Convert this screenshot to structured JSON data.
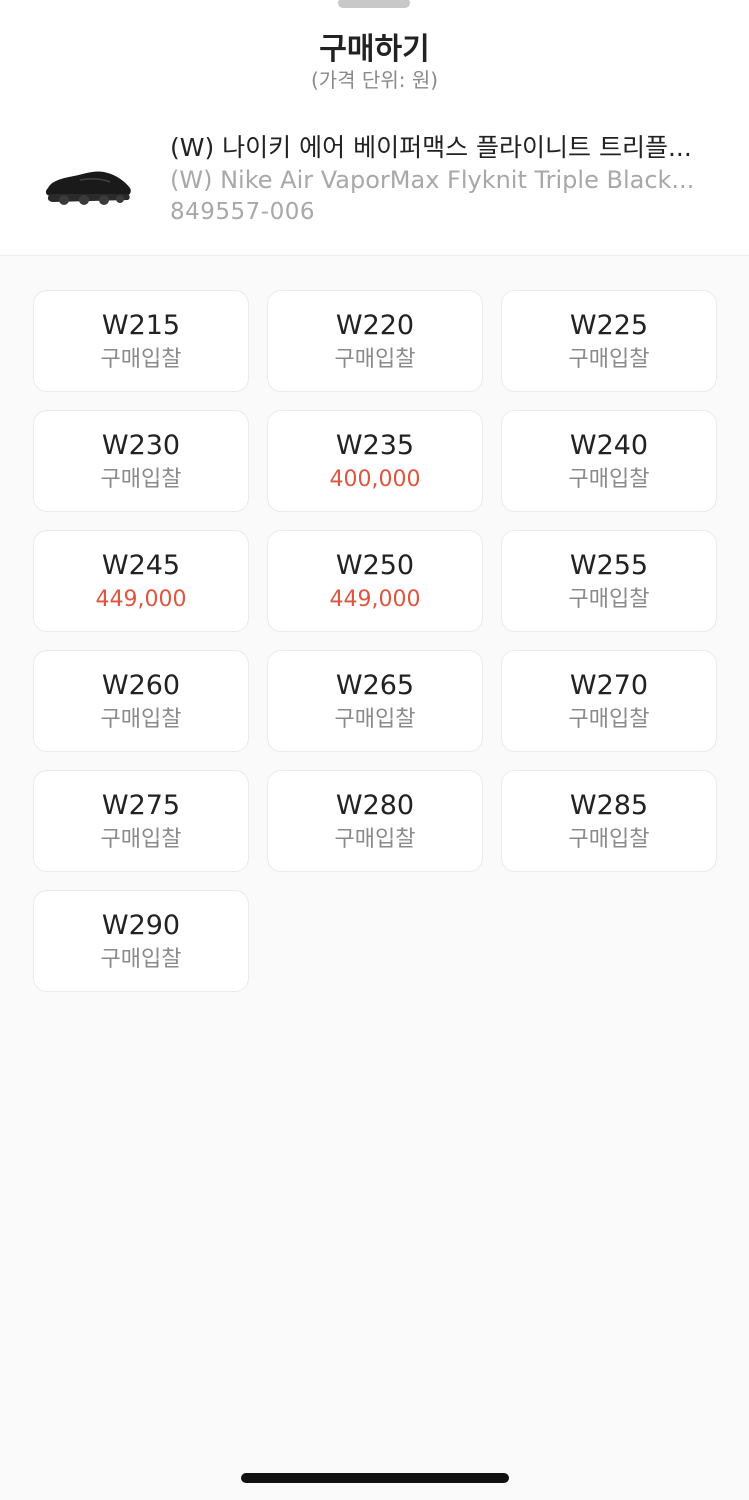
{
  "sheet": {
    "title": "구매하기",
    "subtitle": "(가격 단위: 원)"
  },
  "product": {
    "name_ko": "(W) 나이키 에어 베이퍼맥스 플라이니트 트리플...",
    "name_en": "(W) Nike Air VaporMax Flyknit Triple Black...",
    "code": "849557-006",
    "thumbnail_icon": "sneaker-image"
  },
  "sizes": [
    {
      "size": "W215",
      "price": "구매입찰",
      "has_price": false
    },
    {
      "size": "W220",
      "price": "구매입찰",
      "has_price": false
    },
    {
      "size": "W225",
      "price": "구매입찰",
      "has_price": false
    },
    {
      "size": "W230",
      "price": "구매입찰",
      "has_price": false
    },
    {
      "size": "W235",
      "price": "400,000",
      "has_price": true
    },
    {
      "size": "W240",
      "price": "구매입찰",
      "has_price": false
    },
    {
      "size": "W245",
      "price": "449,000",
      "has_price": true
    },
    {
      "size": "W250",
      "price": "449,000",
      "has_price": true
    },
    {
      "size": "W255",
      "price": "구매입찰",
      "has_price": false
    },
    {
      "size": "W260",
      "price": "구매입찰",
      "has_price": false
    },
    {
      "size": "W265",
      "price": "구매입찰",
      "has_price": false
    },
    {
      "size": "W270",
      "price": "구매입찰",
      "has_price": false
    },
    {
      "size": "W275",
      "price": "구매입찰",
      "has_price": false
    },
    {
      "size": "W280",
      "price": "구매입찰",
      "has_price": false
    },
    {
      "size": "W285",
      "price": "구매입찰",
      "has_price": false
    },
    {
      "size": "W290",
      "price": "구매입찰",
      "has_price": false
    }
  ],
  "colors": {
    "price_accent": "#e0553f",
    "muted_text": "#8a8a8a",
    "primary_text": "#222222"
  }
}
